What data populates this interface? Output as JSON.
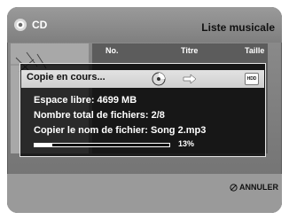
{
  "header": {
    "source_label": "CD",
    "title": "Liste musicale",
    "disc_icon": "disc-icon"
  },
  "list": {
    "columns": [
      "No.",
      "Titre",
      "Taille"
    ]
  },
  "dialog": {
    "title": "Copie en cours...",
    "source_icon": "disc-icon",
    "arrow_icon": "arrow-right-icon",
    "dest_icon": "hdd-icon",
    "dest_label": "HDD",
    "free_space": "Espace libre: 4699 MB",
    "total_files": "Nombre total de fichiers: 2/8",
    "copy_name": "Copier le nom de fichier: Song 2.mp3",
    "progress_percent": 13,
    "progress_text": "13%"
  },
  "footer": {
    "cancel_label": "ANNULER",
    "cancel_icon": "cancel-icon"
  },
  "colors": {
    "dialog_bg": "#000000",
    "progress_fill": "#ffffff",
    "header_text": "#ffffff"
  }
}
